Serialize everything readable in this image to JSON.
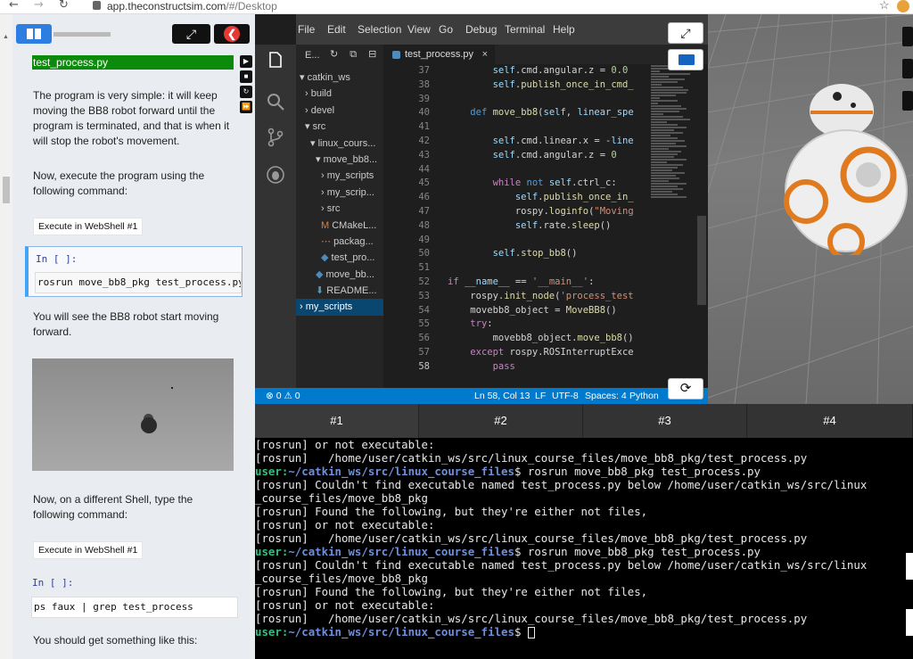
{
  "browser": {
    "back": "←",
    "forward": "→",
    "reload": "↻",
    "url_domain": "app.theconstructsim.com",
    "url_path": "/#/Desktop",
    "star": "☆"
  },
  "notebook": {
    "file_label": "test_process.py",
    "para1": "The program is very simple: it will keep moving the BB8 robot forward until the program is terminated, and that is when it will stop the robot's movement.",
    "para2": "Now, execute the program using the following command:",
    "exec1": "Execute in WebShell #1",
    "cell1_prompt": "In [ ]:",
    "cell1_code": "rosrun move_bb8_pkg test_process.py",
    "para3": "You will see the BB8 robot start moving forward.",
    "para4": "Now, on a different Shell, type the following command:",
    "exec2": "Execute in WebShell #1",
    "cell2_prompt": "In [ ]:",
    "cell2_code": "ps faux | grep test_process",
    "para5": "You should get something like this:",
    "expand_icon": "⤢",
    "close_icon": "❮"
  },
  "ide": {
    "menu": [
      "File",
      "Edit",
      "Selection",
      "View",
      "Go",
      "Debug",
      "Terminal",
      "Help"
    ],
    "explorer_title": "E...",
    "explorer_tools": "↻ ⧉ ⊟",
    "tree": [
      {
        "label": "catkin_ws",
        "icon": "▾",
        "indent": 4
      },
      {
        "label": "build",
        "icon": "›",
        "indent": 10
      },
      {
        "label": "devel",
        "icon": "›",
        "indent": 10
      },
      {
        "label": "src",
        "icon": "▾",
        "indent": 10
      },
      {
        "label": "linux_cours...",
        "icon": "▾",
        "indent": 16
      },
      {
        "label": "move_bb8...",
        "icon": "▾",
        "indent": 22
      },
      {
        "label": "my_scripts",
        "icon": "›",
        "indent": 28
      },
      {
        "label": "my_scrip...",
        "icon": "›",
        "indent": 28
      },
      {
        "label": "src",
        "icon": "›",
        "indent": 28
      },
      {
        "label": "CMakeL...",
        "icon": "M",
        "indent": 28
      },
      {
        "label": "packag...",
        "icon": "⋯",
        "indent": 28
      },
      {
        "label": "test_pro...",
        "icon": "◆",
        "indent": 28
      },
      {
        "label": "move_bb...",
        "icon": "◆",
        "indent": 22
      },
      {
        "label": "README...",
        "icon": "⬇",
        "indent": 22
      },
      {
        "label": "my_scripts",
        "icon": "›",
        "indent": 4,
        "selected": true
      }
    ],
    "tab": "test_process.py",
    "tab_close": "×",
    "line_numbers": [
      "37",
      "38",
      "39",
      "40",
      "41",
      "42",
      "43",
      "44",
      "45",
      "46",
      "47",
      "48",
      "49",
      "50",
      "51",
      "52",
      "53",
      "54",
      "55",
      "56",
      "57",
      "58"
    ],
    "current_line": "58",
    "status": {
      "errors": "⊗ 0 ⚠ 0",
      "position": "Ln 58, Col 13",
      "eol": "LF",
      "encoding": "UTF-8",
      "spaces": "Spaces: 4",
      "language": "Python"
    },
    "expand_icon": "⤢",
    "refresh_icon": "⟳"
  },
  "terminal": {
    "tabs": [
      "#1",
      "#2",
      "#3",
      "#4"
    ],
    "lines": [
      {
        "type": "out",
        "text": "[rosrun] or not executable:"
      },
      {
        "type": "out",
        "text": "[rosrun]   /home/user/catkin_ws/src/linux_course_files/move_bb8_pkg/test_process.py"
      },
      {
        "type": "prompt",
        "user": "user:",
        "path": "~/catkin_ws/src/linux_course_files",
        "cmd": "$ rosrun move_bb8_pkg test_process.py"
      },
      {
        "type": "out",
        "text": "[rosrun] Couldn't find executable named test_process.py below /home/user/catkin_ws/src/linux"
      },
      {
        "type": "out",
        "text": "_course_files/move_bb8_pkg"
      },
      {
        "type": "out",
        "text": "[rosrun] Found the following, but they're either not files,"
      },
      {
        "type": "out",
        "text": "[rosrun] or not executable:"
      },
      {
        "type": "out",
        "text": "[rosrun]   /home/user/catkin_ws/src/linux_course_files/move_bb8_pkg/test_process.py"
      },
      {
        "type": "prompt",
        "user": "user:",
        "path": "~/catkin_ws/src/linux_course_files",
        "cmd": "$ rosrun move_bb8_pkg test_process.py"
      },
      {
        "type": "out",
        "text": "[rosrun] Couldn't find executable named test_process.py below /home/user/catkin_ws/src/linux"
      },
      {
        "type": "out",
        "text": "_course_files/move_bb8_pkg"
      },
      {
        "type": "out",
        "text": "[rosrun] Found the following, but they're either not files,"
      },
      {
        "type": "out",
        "text": "[rosrun] or not executable:"
      },
      {
        "type": "out",
        "text": "[rosrun]   /home/user/catkin_ws/src/linux_course_files/move_bb8_pkg/test_process.py"
      },
      {
        "type": "prompt",
        "user": "user:",
        "path": "~/catkin_ws/src/linux_course_files",
        "cmd": "$ ",
        "cursor": true
      }
    ]
  }
}
